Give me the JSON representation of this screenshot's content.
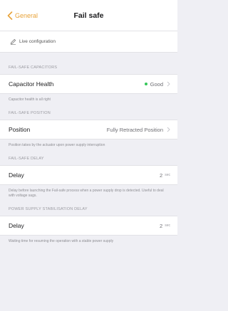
{
  "nav": {
    "back_label": "General",
    "title": "Fail safe"
  },
  "toolbar": {
    "live_config_label": "Live configuration"
  },
  "sections": {
    "capacitors": {
      "header": "FAIL-SAFE CAPACITORS",
      "row_label": "Capacitor Health",
      "row_value": "Good",
      "status_color": "#34c759",
      "footer": "Capacitor health is all right"
    },
    "position": {
      "header": "FAIL-SAFE POSITION",
      "row_label": "Position",
      "row_value": "Fully Retracted Position",
      "footer": "Position takes by the actuator upon power supply interruption"
    },
    "delay": {
      "header": "FAIL-SAFE DELAY",
      "row_label": "Delay",
      "row_value": "2",
      "row_unit": "sec",
      "footer": "Delay before launching the Fail-safe process when a power supply drop is detected. Useful to deal with voltage sags."
    },
    "stabilisation": {
      "header": "POWER SUPPLY STABILISATION DELAY",
      "row_label": "Delay",
      "row_value": "2",
      "row_unit": "sec",
      "footer": "Waiting time for resuming the operation with a stable power supply"
    }
  },
  "colors": {
    "accent": "#e8a33a",
    "background": "#efeff4"
  }
}
